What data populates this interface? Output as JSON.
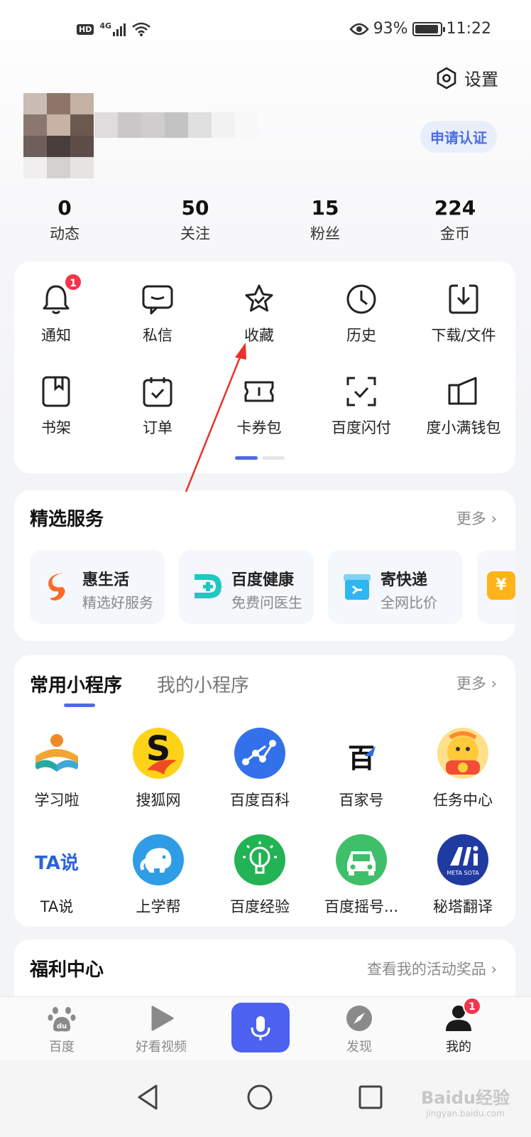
{
  "status_bar": {
    "hd": "HD",
    "network": "4G",
    "battery_percent": "93%",
    "time": "11:22",
    "battery_level": 0.93
  },
  "header": {
    "settings_label": "设置",
    "cert_button": "申请认证"
  },
  "stats": [
    {
      "value": "0",
      "label": "动态"
    },
    {
      "value": "50",
      "label": "关注"
    },
    {
      "value": "15",
      "label": "粉丝"
    },
    {
      "value": "224",
      "label": "金币"
    }
  ],
  "quick_actions": {
    "items": [
      {
        "label": "通知",
        "icon": "bell-icon",
        "badge": "1"
      },
      {
        "label": "私信",
        "icon": "message-icon"
      },
      {
        "label": "收藏",
        "icon": "star-icon"
      },
      {
        "label": "历史",
        "icon": "clock-icon"
      },
      {
        "label": "下载/文件",
        "icon": "download-icon"
      },
      {
        "label": "书架",
        "icon": "bookshelf-icon"
      },
      {
        "label": "订单",
        "icon": "order-icon"
      },
      {
        "label": "卡券包",
        "icon": "coupon-icon"
      },
      {
        "label": "百度闪付",
        "icon": "scan-pay-icon"
      },
      {
        "label": "度小满钱包",
        "icon": "wallet-icon"
      }
    ]
  },
  "services": {
    "title": "精选服务",
    "more": "更多",
    "items": [
      {
        "name": "惠生活",
        "sub": "精选好服务",
        "icon": "hui-life-icon",
        "color": "#ff6a2a"
      },
      {
        "name": "百度健康",
        "sub": "免费问医生",
        "icon": "health-icon",
        "color": "#1fc8c0"
      },
      {
        "name": "寄快递",
        "sub": "全网比价",
        "icon": "express-icon",
        "color": "#2fb6f0"
      }
    ]
  },
  "mini_programs": {
    "tabs": [
      "常用小程序",
      "我的小程序"
    ],
    "more": "更多",
    "apps": [
      {
        "label": "学习啦",
        "icon": "xuexila-icon"
      },
      {
        "label": "搜狐网",
        "icon": "sohu-icon"
      },
      {
        "label": "百度百科",
        "icon": "baike-icon"
      },
      {
        "label": "百家号",
        "icon": "baijiahao-icon",
        "glyph": "百"
      },
      {
        "label": "任务中心",
        "icon": "task-center-icon"
      },
      {
        "label": "TA说",
        "icon": "ta-shuo-icon",
        "glyph": "TA说"
      },
      {
        "label": "上学帮",
        "icon": "elephant-icon"
      },
      {
        "label": "百度经验",
        "icon": "lightbulb-icon"
      },
      {
        "label": "百度摇号...",
        "icon": "car-icon"
      },
      {
        "label": "秘塔翻译",
        "icon": "metasota-icon",
        "glyph": "META SOTA"
      }
    ]
  },
  "welfare": {
    "title": "福利中心",
    "link": "查看我的活动奖品"
  },
  "bottom_nav": [
    {
      "label": "百度",
      "icon": "paw-icon"
    },
    {
      "label": "好看视频",
      "icon": "play-icon"
    },
    {
      "label": "",
      "icon": "mic-icon"
    },
    {
      "label": "发现",
      "icon": "compass-icon"
    },
    {
      "label": "我的",
      "icon": "user-icon",
      "badge": "1"
    }
  ],
  "watermark": {
    "text": "Baidu经验",
    "sub": "jingyan.baidu.com"
  },
  "colors": {
    "accent": "#4d62f0",
    "badge": "#f5334a",
    "tab_underline": "#4d6ae6",
    "annotation_arrow": "#e8332a"
  }
}
